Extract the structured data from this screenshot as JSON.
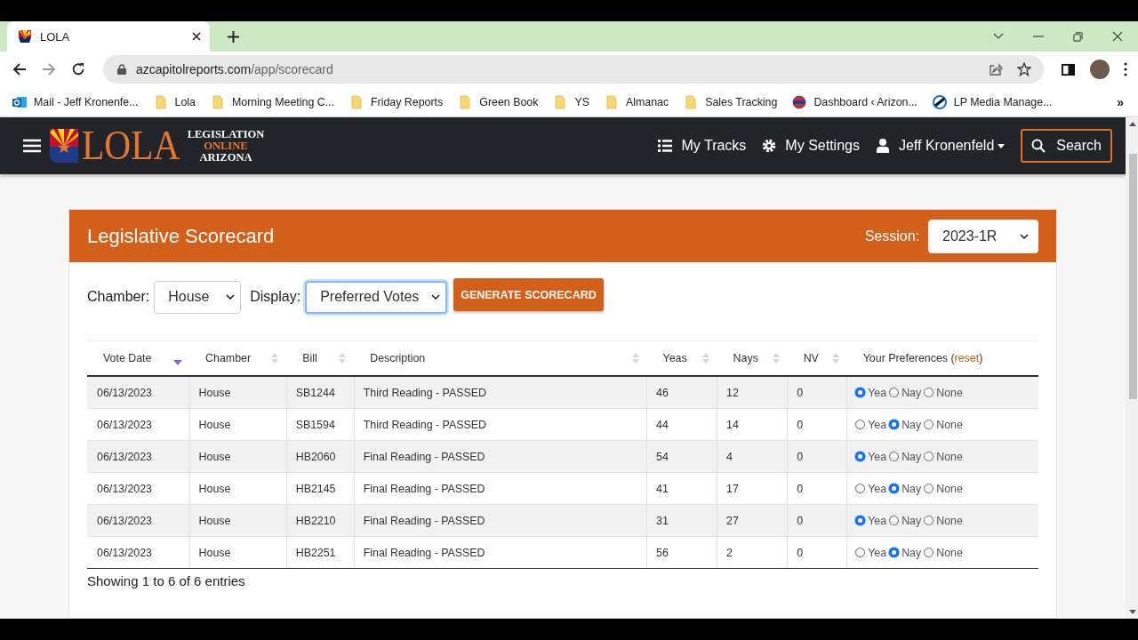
{
  "browser": {
    "tab": {
      "title": "LOLA"
    },
    "url": {
      "host": "azcapitolreports.com",
      "path": "/app/scorecard"
    },
    "bookmarks": [
      {
        "label": "Mail - Jeff Kronenfe...",
        "kind": "mail"
      },
      {
        "label": "Lola",
        "kind": "folder"
      },
      {
        "label": "Morning Meeting C...",
        "kind": "folder"
      },
      {
        "label": "Friday Reports",
        "kind": "folder"
      },
      {
        "label": "Green Book",
        "kind": "folder"
      },
      {
        "label": "YS",
        "kind": "folder"
      },
      {
        "label": "Almanac",
        "kind": "folder"
      },
      {
        "label": "Sales Tracking",
        "kind": "folder"
      },
      {
        "label": "Dashboard ‹ Arizon...",
        "kind": "site"
      },
      {
        "label": "LP Media Manage...",
        "kind": "media"
      }
    ],
    "overflow": "»"
  },
  "app": {
    "logo": {
      "word": "LOLA",
      "line_1": "LEGISLATION",
      "line_2": "ONLINE",
      "line_3": "ARIZONA"
    },
    "nav": [
      {
        "label": "My Tracks",
        "kind": "list"
      },
      {
        "label": "My Settings",
        "kind": "gear"
      },
      {
        "label": "Jeff Kronenfeld",
        "kind": "user"
      }
    ],
    "search_button": "Search"
  },
  "card": {
    "title": "Legislative Scorecard",
    "session": {
      "label": "Session:",
      "value": "2023-1R"
    },
    "filters": [
      {
        "label": "Chamber:",
        "value": "House",
        "focused": false
      },
      {
        "label": "Display:",
        "value": "Preferred Votes",
        "focused": true
      }
    ],
    "generate_button": "GENERATE SCORECARD",
    "table": {
      "columns": [
        {
          "label": "Vote Date",
          "sorted": true
        },
        {
          "label": "Chamber",
          "sorted": false
        },
        {
          "label": "Bill",
          "sorted": false
        },
        {
          "label": "Description",
          "sorted": false
        },
        {
          "label": "Yeas",
          "sorted": false
        },
        {
          "label": "Nays",
          "sorted": false
        },
        {
          "label": "NV",
          "sorted": false
        }
      ],
      "preferences_header": {
        "before": "Your Preferences (",
        "link": "reset",
        "after": ")"
      },
      "rows": [
        {
          "cells": [
            "06/13/2023",
            "House",
            "SB1244",
            "Third Reading - PASSED",
            "46",
            "12",
            "0"
          ],
          "preferences": [
            {
              "label": "Yea",
              "selected": true
            },
            {
              "label": "Nay",
              "selected": false
            },
            {
              "label": "None",
              "selected": false
            }
          ]
        },
        {
          "cells": [
            "06/13/2023",
            "House",
            "SB1594",
            "Third Reading - PASSED",
            "44",
            "14",
            "0"
          ],
          "preferences": [
            {
              "label": "Yea",
              "selected": false
            },
            {
              "label": "Nay",
              "selected": true
            },
            {
              "label": "None",
              "selected": false
            }
          ]
        },
        {
          "cells": [
            "06/13/2023",
            "House",
            "HB2060",
            "Final Reading - PASSED",
            "54",
            "4",
            "0"
          ],
          "preferences": [
            {
              "label": "Yea",
              "selected": true
            },
            {
              "label": "Nay",
              "selected": false
            },
            {
              "label": "None",
              "selected": false
            }
          ]
        },
        {
          "cells": [
            "06/13/2023",
            "House",
            "HB2145",
            "Final Reading - PASSED",
            "41",
            "17",
            "0"
          ],
          "preferences": [
            {
              "label": "Yea",
              "selected": false
            },
            {
              "label": "Nay",
              "selected": true
            },
            {
              "label": "None",
              "selected": false
            }
          ]
        },
        {
          "cells": [
            "06/13/2023",
            "House",
            "HB2210",
            "Final Reading - PASSED",
            "31",
            "27",
            "0"
          ],
          "preferences": [
            {
              "label": "Yea",
              "selected": true
            },
            {
              "label": "Nay",
              "selected": false
            },
            {
              "label": "None",
              "selected": false
            }
          ]
        },
        {
          "cells": [
            "06/13/2023",
            "House",
            "HB2251",
            "Final Reading - PASSED",
            "56",
            "2",
            "0"
          ],
          "preferences": [
            {
              "label": "Yea",
              "selected": false
            },
            {
              "label": "Nay",
              "selected": true
            },
            {
              "label": "None",
              "selected": false
            }
          ]
        }
      ]
    },
    "footer": "Showing 1 to 6 of 6 entries"
  }
}
